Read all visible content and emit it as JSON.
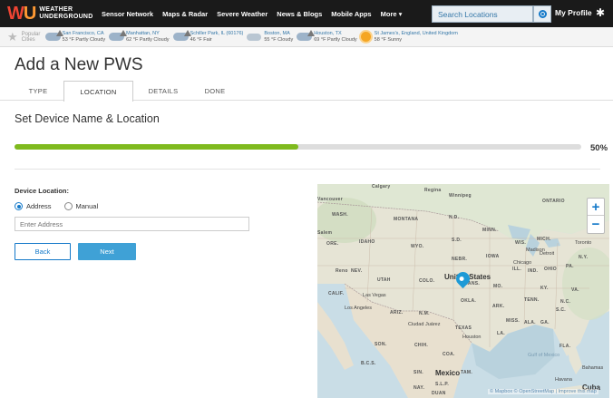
{
  "header": {
    "logo_mark_w": "W",
    "logo_mark_u": "U",
    "logo_line1": "WEATHER",
    "logo_line2": "UNDERGROUND",
    "nav": [
      "Sensor Network",
      "Maps & Radar",
      "Severe Weather",
      "News & Blogs",
      "Mobile Apps",
      "More"
    ],
    "search_value": "Search Locations",
    "profile_label": "My Profile",
    "icons": {
      "locate": "target-icon",
      "settings": "gear-icon"
    }
  },
  "cities_bar": {
    "popular_line1": "Popular",
    "popular_line2": "Cities",
    "cities": [
      {
        "name": "San Francisco, CA",
        "cond": "53 °F Partly Cloudy",
        "icon": "cloud-icon"
      },
      {
        "name": "Manhattan, NY",
        "cond": "62 °F Partly Cloudy",
        "icon": "cloud-icon"
      },
      {
        "name": "Schiller Park, IL (60176)",
        "cond": "46 °F Fair",
        "icon": "cloud-icon"
      },
      {
        "name": "Boston, MA",
        "cond": "55 °F Cloudy",
        "icon": "cloud-icon"
      },
      {
        "name": "Houston, TX",
        "cond": "69 °F Partly Cloudy",
        "icon": "cloud-icon"
      },
      {
        "name": "St James's, England, United Kingdom",
        "cond": "58 °F Sunny",
        "icon": "sun-icon"
      }
    ]
  },
  "page": {
    "title": "Add a New PWS",
    "tabs": [
      "TYPE",
      "LOCATION",
      "DETAILS",
      "DONE"
    ],
    "active_tab": "LOCATION",
    "section_title": "Set Device Name & Location",
    "progress": {
      "value": 0.5,
      "label": "50%",
      "color": "#7fba1e"
    }
  },
  "form": {
    "device_location_label": "Device Location:",
    "radio_address": "Address",
    "radio_manual": "Manual",
    "selected": "Address",
    "address_placeholder": "Enter Address",
    "back_label": "Back",
    "next_label": "Next"
  },
  "map": {
    "countries": [
      "United States",
      "Mexico",
      "Cuba"
    ],
    "regions": [
      "Vancouver",
      "WASH.",
      "MONTANA",
      "N.D.",
      "MINN.",
      "ONTARIO",
      "QUE",
      "Salem",
      "ORE.",
      "IDAHO",
      "WYO.",
      "S.D.",
      "WIS.",
      "MICH.",
      "NEBR.",
      "IOWA",
      "Reno",
      "NEV.",
      "UTAH",
      "COLO.",
      "KANS.",
      "MO.",
      "ILL.",
      "IND.",
      "OHIO",
      "PA.",
      "N.Y.",
      "CALIF.",
      "Las Vegas",
      "OKLA.",
      "ARK.",
      "TENN.",
      "KY.",
      "VA.",
      "N.C.",
      "Los Angeles",
      "ARIZ.",
      "N.M.",
      "TEXAS",
      "MISS.",
      "ALA.",
      "GA.",
      "S.C.",
      "Ciudad Juárez",
      "Houston",
      "LA.",
      "FLA.",
      "SON.",
      "CHIH.",
      "COA.",
      "B.C.S.",
      "SIN.",
      "TAM.",
      "S.L.P.",
      "NAY.",
      "DUAN",
      "Calgary",
      "Regina",
      "Winnipeg",
      "Madison",
      "Detroit",
      "Chicago",
      "Toronto",
      "Havana",
      "Bahamas",
      "Gulf of Mexico",
      "Cuba",
      "Mexico"
    ],
    "zoom_in": "+",
    "zoom_out": "−",
    "attribution": "© Mapbox © OpenStreetMap | Improve this map"
  }
}
